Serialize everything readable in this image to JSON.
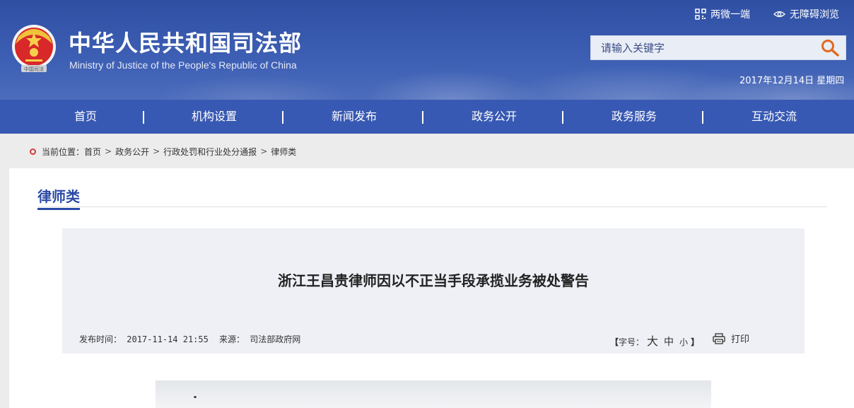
{
  "header": {
    "title": "中华人民共和国司法部",
    "subtitle": "Ministry of Justice of the People's Republic of China",
    "emblem_text": "中国司法",
    "links": {
      "mobile": "两微一端",
      "accessibility": "无障碍浏览"
    },
    "search": {
      "placeholder": "请输入关键字",
      "value": ""
    },
    "date": "2017年12月14日 星期四"
  },
  "nav": {
    "items": [
      {
        "label": "首页"
      },
      {
        "label": "机构设置"
      },
      {
        "label": "新闻发布"
      },
      {
        "label": "政务公开"
      },
      {
        "label": "政务服务"
      },
      {
        "label": "互动交流"
      }
    ]
  },
  "breadcrumb": {
    "prefix": "当前位置：",
    "items": [
      "首页",
      "政务公开",
      "行政处罚和行业处分通报",
      "律师类"
    ],
    "separator": ">"
  },
  "section": {
    "title": "律师类"
  },
  "article": {
    "title": "浙江王昌贵律师因以不正当手段承揽业务被处警告",
    "pubtime_label": "发布时间：",
    "pubtime": "2017-11-14 21:55",
    "source_label": "来源：",
    "source": "司法部政府网",
    "fontsize_open": "【",
    "fontsize_label": "字号：",
    "fontsize_big": "大",
    "fontsize_mid": "中",
    "fontsize_small": "小",
    "fontsize_close": "】",
    "print_label": "打印"
  },
  "colors": {
    "header_blue": "#3859b3",
    "accent_blue": "#2a4aa6",
    "crumb_dot": "#d23b3b",
    "search_icon": "#e06a1e"
  }
}
